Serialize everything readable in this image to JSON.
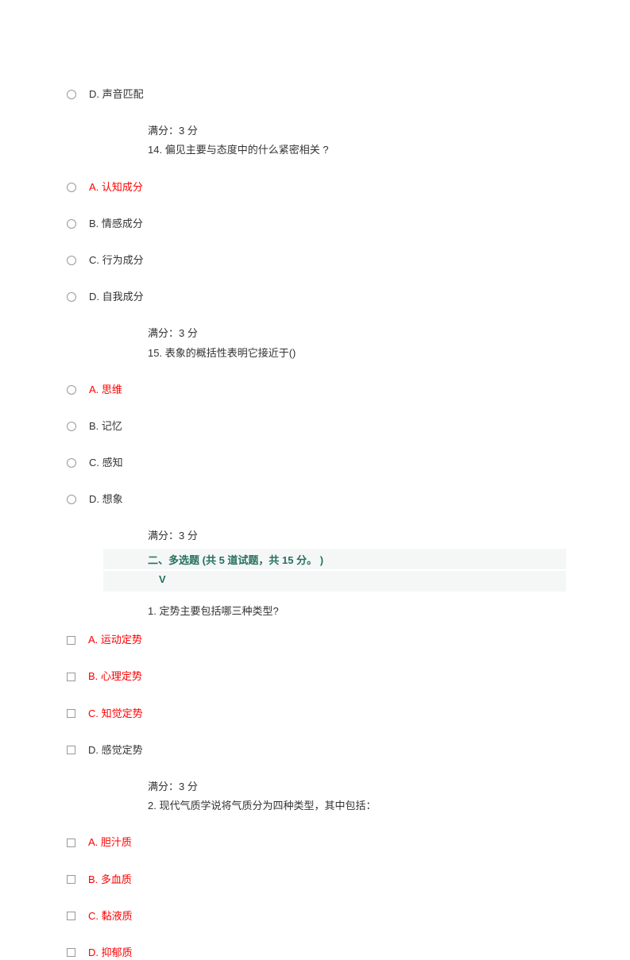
{
  "q13_last_option": {
    "letter": "D.",
    "text": "声音匹配"
  },
  "score_label": "满分：3  分",
  "q14": {
    "num": "14.",
    "text": "偏见主要与态度中的什么紧密相关  ?",
    "options": [
      {
        "letter": "A.",
        "text": "认知成分",
        "red": true
      },
      {
        "letter": "B.",
        "text": "情感成分",
        "red": false
      },
      {
        "letter": "C.",
        "text": "行为成分",
        "red": false
      },
      {
        "letter": "D.",
        "text": "自我成分",
        "red": false
      }
    ]
  },
  "q15": {
    "num": "15.",
    "text": "表象的概括性表明它接近于()",
    "options": [
      {
        "letter": "A.",
        "text": "思维",
        "red": true
      },
      {
        "letter": "B.",
        "text": "记忆",
        "red": false
      },
      {
        "letter": "C.",
        "text": "感知",
        "red": false
      },
      {
        "letter": "D.",
        "text": "想象",
        "red": false
      }
    ]
  },
  "section2": {
    "title_pre": "二、多选题  (共 ",
    "count": "5",
    "mid": " 道试题，共 ",
    "points": "15",
    "suffix": " 分。 )",
    "v": "V"
  },
  "m1": {
    "num": "1.",
    "text": "定势主要包括哪三种类型?",
    "options": [
      {
        "letter": "A.",
        "text": "运动定势",
        "red": true
      },
      {
        "letter": "B.",
        "text": "心理定势",
        "red": true
      },
      {
        "letter": "C.",
        "text": "知觉定势",
        "red": true
      },
      {
        "letter": "D.",
        "text": "感觉定势",
        "red": false
      }
    ]
  },
  "m2": {
    "num": "2.",
    "text": "现代气质学说将气质分为四种类型，其中包括：",
    "options": [
      {
        "letter": "A.",
        "text": "胆汁质",
        "red": true
      },
      {
        "letter": "B.",
        "text": "多血质",
        "red": true
      },
      {
        "letter": "C.",
        "text": "黏液质",
        "red": true
      },
      {
        "letter": "D.",
        "text": "抑郁质",
        "red": true
      }
    ]
  }
}
